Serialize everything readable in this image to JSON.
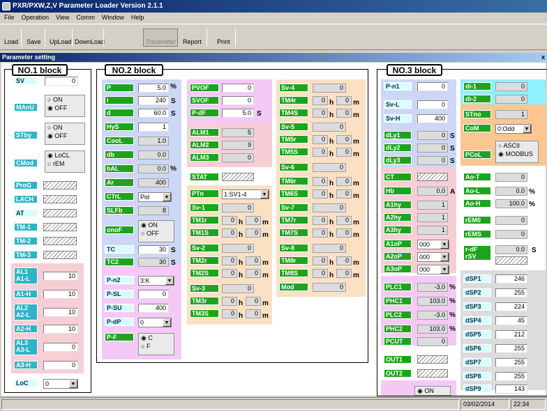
{
  "window": {
    "title": "PXR/PXW,Z,V Parameter Loader Version 2.1.1"
  },
  "menu": [
    "File",
    "Operation",
    "View",
    "Comm",
    "Window",
    "Help"
  ],
  "toolbar": {
    "load": "Load",
    "save": "Save",
    "upload": "UpLoad",
    "download": "DownLoad",
    "parameter": "Parameter",
    "report": "Report",
    "print": "Print"
  },
  "subwindow": {
    "title": "Parameter setting",
    "close": "x"
  },
  "blocks": {
    "b1": "NO.1 block",
    "b2": "NO.2 block",
    "b3": "NO.3 block"
  },
  "units": {
    "pct": "%",
    "s": "S",
    "h": "h",
    "m": "m",
    "a": "A"
  },
  "radios": {
    "on": "ON",
    "off": "OFF",
    "locl": "LoCL",
    "rem": "rEM",
    "c": "C",
    "f": "F",
    "ascii": "ASCII",
    "modbus": "MODBUS",
    "on2": "ON"
  },
  "p1": {
    "sv": "SV",
    "sv_v": "0",
    "manu": "MAnU",
    "stby": "STby",
    "cmod": "CMod",
    "prog": "ProG",
    "lach": "LACH",
    "at": "AT",
    "tm1": "TM-1",
    "tm2": "TM-2",
    "tm3": "TM-3",
    "a1l": "AL1\nA1-L",
    "a1l_v": "10",
    "a1h": "A1-H",
    "a1h_v": "10",
    "a2l": "AL2\nA2-L",
    "a2l_v": "10",
    "a2h": "A2-H",
    "a2h_v": "10",
    "a3l": "AL3\nA3-L",
    "a3l_v": "0",
    "a3h": "A3-H",
    "a3h_v": "0",
    "loc": "LoC",
    "loc_v": "0"
  },
  "p2a": {
    "p": "P",
    "p_v": "5.0",
    "i": "i",
    "i_v": "240",
    "d": "d",
    "d_v": "60.0",
    "hys": "HyS",
    "hys_v": "1",
    "cool": "CooL",
    "cool_v": "1.0",
    "db": "db",
    "db_v": "0.0",
    "bal": "bAL",
    "bal_v": "0.0",
    "ar": "Ar",
    "ar_v": "400",
    "ctrl": "CTrL",
    "ctrl_v": "Pid",
    "slfb": "SLFb",
    "slfb_v": "8",
    "onof": "onoF",
    "tc": "TC",
    "tc_v": "30",
    "tc2": "TC2",
    "tc2_v": "30",
    "pn2": "P-n2",
    "pn2_v": "3:K",
    "psl": "P-SL",
    "psl_v": "0",
    "psu": "P-SU",
    "psu_v": "400",
    "pdp": "P-dP",
    "pdp_v": "0",
    "pf": "P-F"
  },
  "p2b": {
    "pvof": "PVOF",
    "pvof_v": "0",
    "svof": "SVOF",
    "svof_v": "0",
    "pdf": "P-dF",
    "pdf_v": "5.0",
    "alm1": "ALM1",
    "alm1_v": "5",
    "alm2": "ALM2",
    "alm2_v": "9",
    "alm3": "ALM3",
    "alm3_v": "0",
    "stat": "STAT",
    "ptn": "PTn",
    "ptn_v": "1:SV1-4",
    "sv1": "Sv-1",
    "sv1_v": "0",
    "tm1r": "TM1r",
    "tm1s": "TM1S",
    "sv2": "Sv-2",
    "sv2_v": "0",
    "tm2r": "TM2r",
    "tm2s": "TM2S",
    "sv3": "Sv-3",
    "sv3_v": "0",
    "tm3r": "TM3r",
    "tm3s": "TM3S"
  },
  "p2c": {
    "sv4": "Sv-4",
    "sv4_v": "0",
    "tm4r": "TM4r",
    "tm4s": "TM4S",
    "sv5": "Sv-5",
    "sv5_v": "0",
    "tm5r": "TM5r",
    "tm5s": "TM5S",
    "sv6": "Sv-6",
    "sv6_v": "0",
    "tm6r": "TM6r",
    "tm6s": "TM6S",
    "sv7": "Sv-7",
    "sv7_v": "0",
    "tm7r": "TM7r",
    "tm7s": "TM7S",
    "sv8": "Sv-8",
    "sv8_v": "0",
    "tm8r": "TM8r",
    "tm8s": "TM8S",
    "mod": "Mod",
    "mod_v": "0",
    "zero": "0"
  },
  "p3": {
    "pn1": "P-n1",
    "pn1_v": "0",
    "svl": "Sv-L",
    "svl_v": "0",
    "svh": "Sv-H",
    "svh_v": "400",
    "dly1": "dLy1",
    "dly1_v": "0",
    "dly2": "dLy2",
    "dly2_v": "0",
    "dly3": "dLy3",
    "dly3_v": "0",
    "ct": "CT",
    "hb": "Hb",
    "hb_v": "0.0",
    "a1hy": "A1hy",
    "a1hy_v": "1",
    "a2hy": "A2hy",
    "a2hy_v": "1",
    "a3hy": "A3hy",
    "a3hy_v": "1",
    "a1op": "A1oP",
    "a1op_v": "000",
    "a2op": "A2oP",
    "a2op_v": "000",
    "a3op": "A3oP",
    "a3op_v": "000",
    "plc1": "PLC1",
    "plc1_v": "-3.0",
    "phc1": "PHC1",
    "phc1_v": "103.0",
    "plc2": "PLC2",
    "plc2_v": "-3.0",
    "phc2": "PHC2",
    "phc2_v": "103.0",
    "pcut": "PCUT",
    "pcut_v": "0",
    "out1": "OUT1",
    "out2": "OUT2"
  },
  "p4": {
    "di1": "di-1",
    "di1_v": "0",
    "di2": "di-2",
    "di2_v": "0",
    "stno": "STno",
    "stno_v": "1",
    "com": "CoM",
    "com_v": "0:Odd",
    "pcol": "PCoL",
    "aot": "Ao-T",
    "aot_v": "0",
    "aol": "Ao-L",
    "aol_v": "0.0",
    "aoh": "Ao-H",
    "aoh_v": "100.0",
    "rem0": "rEM0",
    "rem0_v": "0",
    "rems": "rEMS",
    "rems_v": "0",
    "rdf": "r-dF\nrSV",
    "rdf_v": "0.0",
    "dsp1": "dSP1",
    "dsp1_v": "246",
    "dsp2": "dSP2",
    "dsp2_v": "255",
    "dsp3": "dSP3",
    "dsp3_v": "224",
    "dsp4": "dSP4",
    "dsp4_v": "45",
    "dsp5": "dSP5",
    "dsp5_v": "212",
    "dsp6": "dSP6",
    "dsp6_v": "255",
    "dsp7": "dSP7",
    "dsp7_v": "255",
    "dsp8": "dSP8",
    "dsp8_v": "255",
    "dsp9": "dSP9",
    "dsp9_v": "143"
  },
  "status": {
    "date": "03/02/2014",
    "time": "22:34"
  }
}
